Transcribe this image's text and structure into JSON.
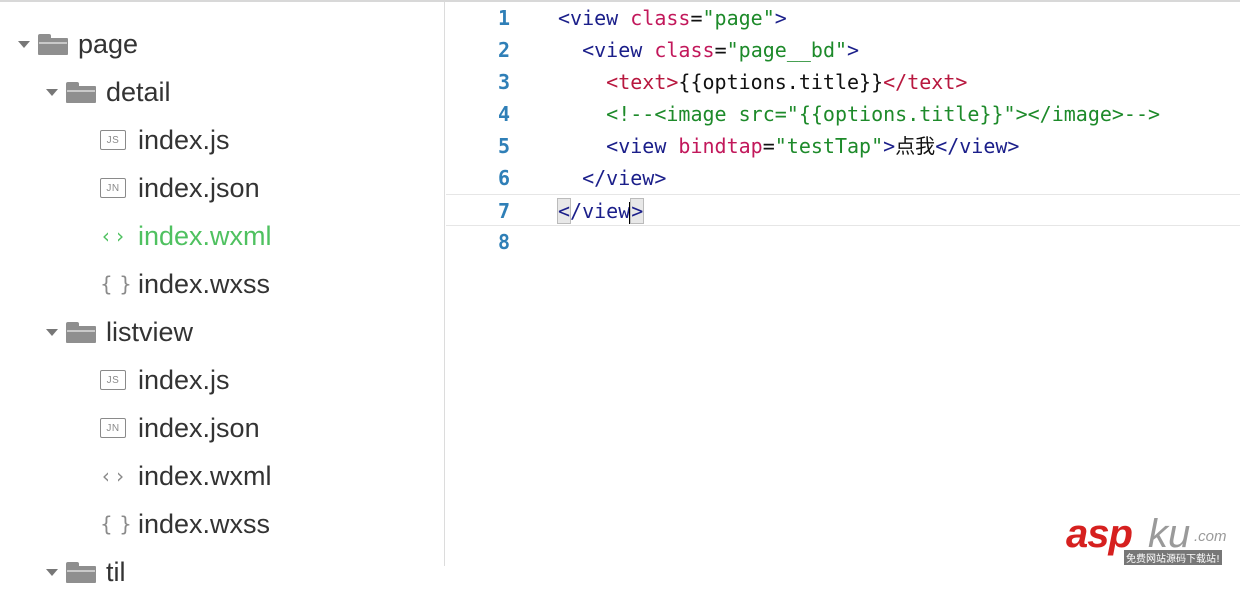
{
  "tree": {
    "page_folder": "page",
    "detail_folder": "detail",
    "detail_files": [
      {
        "icon": "JS",
        "name": "index.js"
      },
      {
        "icon": "JN",
        "name": "index.json"
      },
      {
        "icon": "‹ ›",
        "name": "index.wxml"
      },
      {
        "icon": "{ }",
        "name": "index.wxss"
      }
    ],
    "listview_folder": "listview",
    "listview_files": [
      {
        "icon": "JS",
        "name": "index.js"
      },
      {
        "icon": "JN",
        "name": "index.json"
      },
      {
        "icon": "‹ ›",
        "name": "index.wxml"
      },
      {
        "icon": "{ }",
        "name": "index.wxss"
      }
    ],
    "partial_folder": "til"
  },
  "editor": {
    "line_numbers": [
      "1",
      "2",
      "3",
      "4",
      "5",
      "6",
      "7",
      "8"
    ],
    "lines": [
      {
        "open": "<view ",
        "attr": "class",
        "eq": "=",
        "str": "\"page\"",
        "close": ">"
      },
      {
        "indent": "  ",
        "open": "<view ",
        "attr": "class",
        "eq": "=",
        "str": "\"page__bd\"",
        "close": ">"
      },
      {
        "indent": "    ",
        "open": "<text>",
        "text": "{{options.title}}",
        "close": "</text>"
      },
      {
        "indent": "    ",
        "comment": "<!--<image src=\"{{options.title}}\"></image>-->"
      },
      {
        "indent": "    ",
        "open": "<view ",
        "attr": "bindtap",
        "eq": "=",
        "str": "\"testTap\"",
        "gt": ">",
        "text": "点我",
        "close": "</view>"
      },
      {
        "indent": "  ",
        "close": "</view>"
      },
      {
        "lt": "<",
        "close": "/view",
        "gt": ">"
      }
    ]
  },
  "watermark": {
    "asp": "asp",
    "ku": "ku",
    "com": ".com",
    "sub": "免费网站源码下载站!"
  },
  "colors": {
    "active_file": "#4fc160",
    "line_number": "#2f7fb7",
    "tag": "#1b1f8a",
    "attr": "#c2185b",
    "string": "#1d8a2a"
  }
}
